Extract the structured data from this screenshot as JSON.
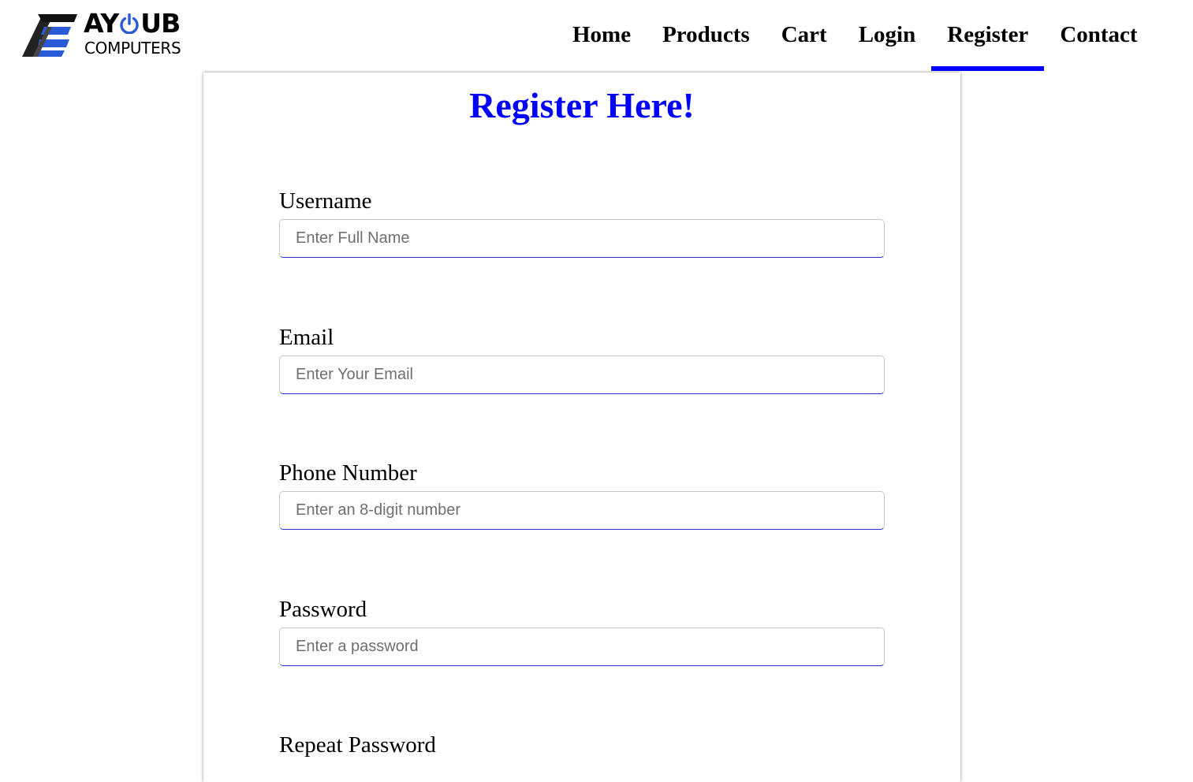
{
  "brand": {
    "name_top_left": "AY",
    "name_top_right": "UB",
    "name_bottom": "COMPUTERS",
    "accent_color": "#2a5bd7"
  },
  "nav": {
    "items": [
      {
        "label": "Home",
        "active": false
      },
      {
        "label": "Products",
        "active": false
      },
      {
        "label": "Cart",
        "active": false
      },
      {
        "label": "Login",
        "active": false
      },
      {
        "label": "Register",
        "active": true
      },
      {
        "label": "Contact",
        "active": false
      }
    ],
    "active_color": "#0000ff"
  },
  "form": {
    "title": "Register Here!",
    "title_color": "#0000ff",
    "fields": [
      {
        "label": "Username",
        "placeholder": "Enter Full Name"
      },
      {
        "label": "Email",
        "placeholder": "Enter Your Email"
      },
      {
        "label": "Phone Number",
        "placeholder": "Enter an 8-digit number"
      },
      {
        "label": "Password",
        "placeholder": "Enter a password"
      },
      {
        "label": "Repeat Password"
      }
    ]
  },
  "icons": {
    "logo": "ayoub-logo-mark-icon",
    "power": "power-icon"
  }
}
